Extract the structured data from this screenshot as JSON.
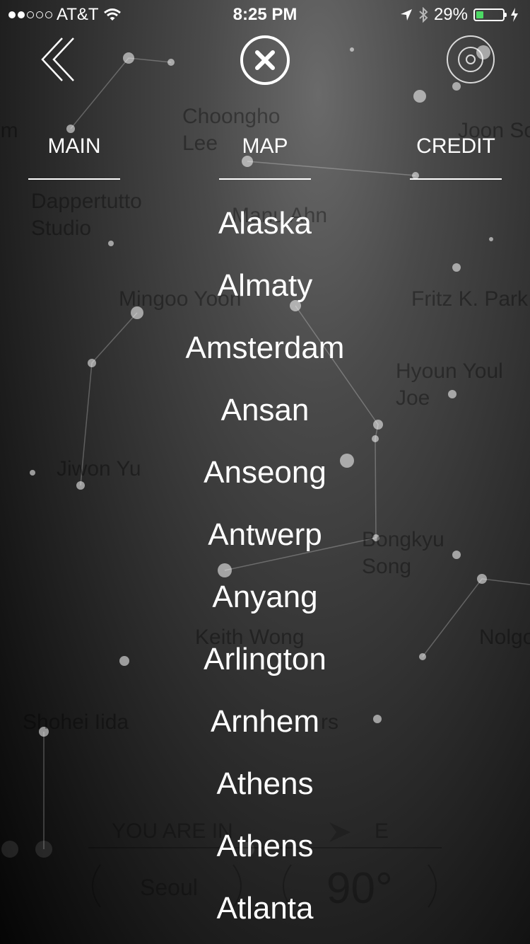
{
  "status_bar": {
    "carrier": "AT&T",
    "time": "8:25 PM",
    "battery": "29%",
    "battery_level": 0.29
  },
  "tabs": [
    {
      "label": "MAIN"
    },
    {
      "label": "MAP"
    },
    {
      "label": "CREDIT"
    }
  ],
  "background_names": [
    {
      "text": "im"
    },
    {
      "text": "Choongho\nLee"
    },
    {
      "text": "Joon So"
    },
    {
      "text": "Dappertutto\nStudio"
    },
    {
      "text": "Manu Ahn"
    },
    {
      "text": "Mingoo Yoon"
    },
    {
      "text": "Fritz K. Park"
    },
    {
      "text": "Hyoun Youl\nJoe"
    },
    {
      "text": "Jiwon Yu"
    },
    {
      "text": "Bongkyu\nSong"
    },
    {
      "text": "Keith Wong"
    },
    {
      "text": "Nolgo"
    },
    {
      "text": "Shohei Iida"
    },
    {
      "text": "rs"
    }
  ],
  "location_panel": {
    "you_are_in": "YOU ARE IN",
    "direction": "E",
    "city": "Seoul",
    "degrees": "90°"
  },
  "cities": [
    "Alaska",
    "Almaty",
    "Amsterdam",
    "Ansan",
    "Anseong",
    "Antwerp",
    "Anyang",
    "Arlington",
    "Arnhem",
    "Athens",
    "Athens",
    "Atlanta"
  ],
  "icons": {
    "back": "double-chevron-left-icon",
    "close": "close-circle-icon",
    "target": "target-icon"
  }
}
